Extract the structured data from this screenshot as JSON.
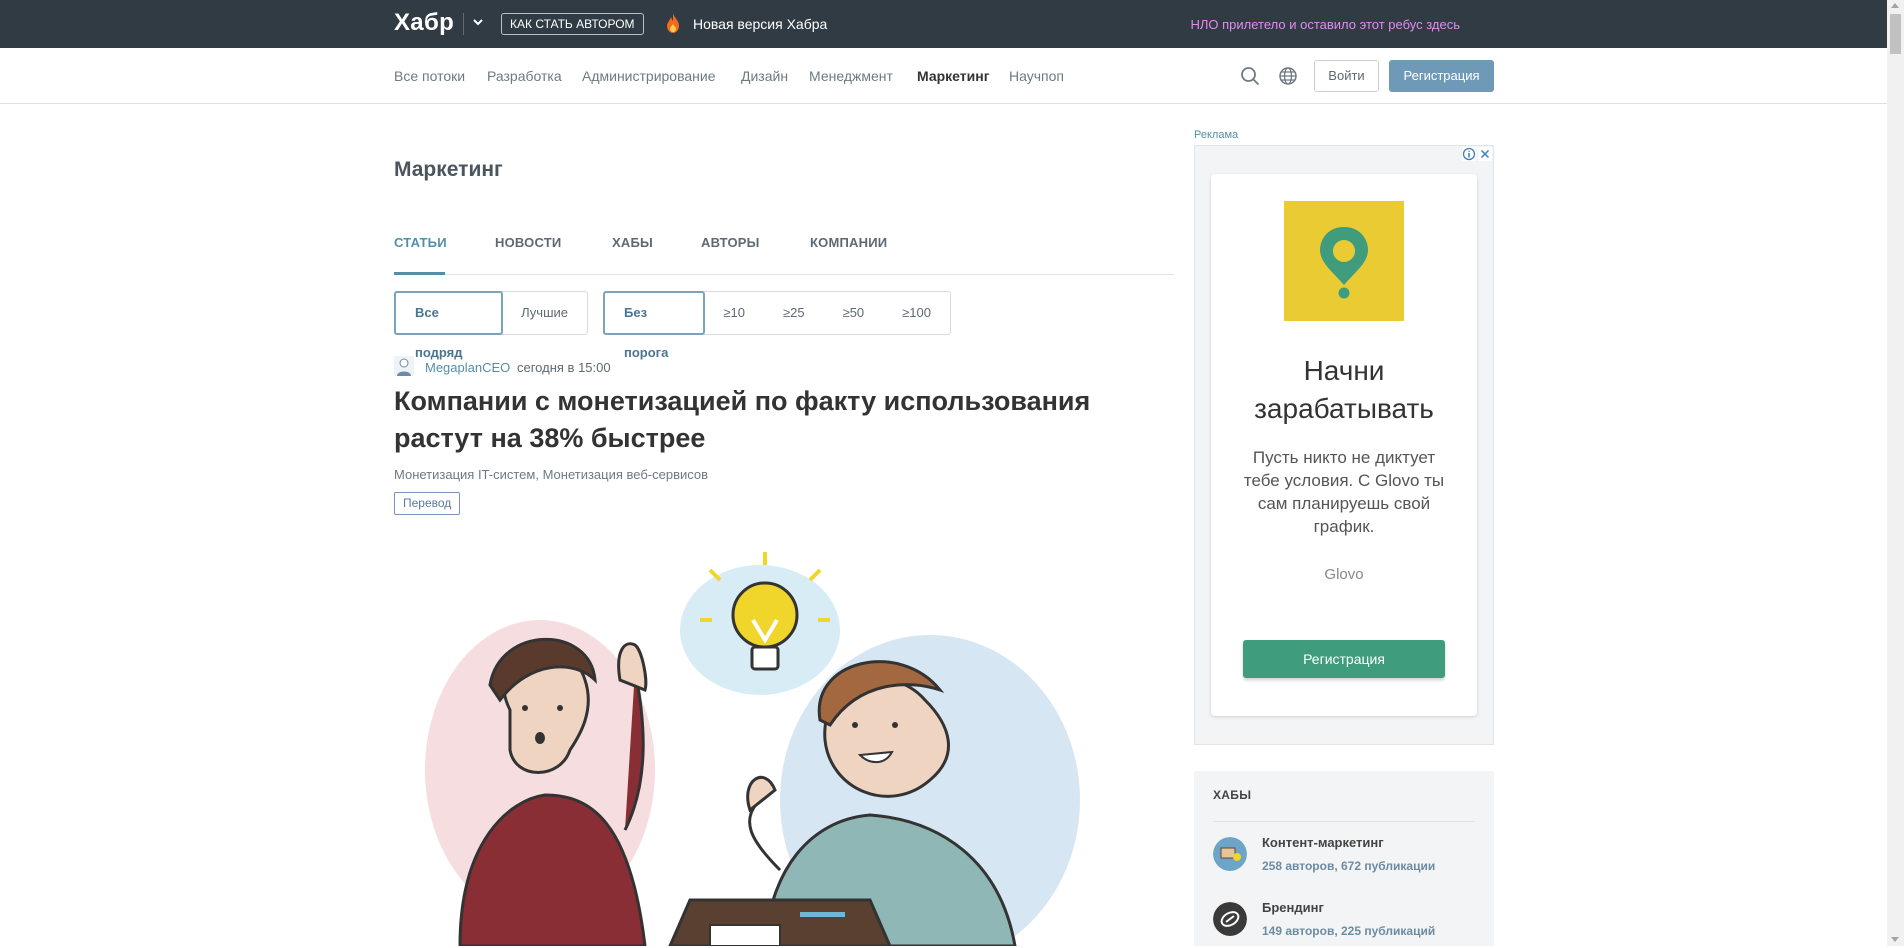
{
  "topbar": {
    "logo": "Хабр",
    "become_author": "КАК СТАТЬ АВТОРОМ",
    "new_version": "Новая версия Хабра",
    "ufo_note": "НЛО прилетело и оставило этот ребус здесь"
  },
  "nav": {
    "items": [
      "Все потоки",
      "Разработка",
      "Администрирование",
      "Дизайн",
      "Менеджмент",
      "Маркетинг",
      "Научпоп"
    ],
    "active": "Маркетинг",
    "login": "Войти",
    "register": "Регистрация"
  },
  "hub": {
    "title": "Маркетинг",
    "tabs": [
      "Статьи",
      "Новости",
      "Хабы",
      "Авторы",
      "Компании"
    ],
    "active_tab": "Статьи"
  },
  "filters": {
    "sort": [
      "Все подряд",
      "Лучшие"
    ],
    "sort_active": "Все подряд",
    "threshold": [
      "Без порога",
      "≥10",
      "≥25",
      "≥50",
      "≥100"
    ],
    "threshold_active": "Без порога"
  },
  "post": {
    "author": "MegaplanCEO",
    "time": "сегодня в 15:00",
    "title": "Компании с монетизацией по факту использования растут на 38% быстрее",
    "hubs": "Монетизация IT-систем,  Монетизация веб-сервисов",
    "badge": "Перевод"
  },
  "ad": {
    "label": "Реклама",
    "headline": "Начни зарабатывать",
    "body": "Пусть никто не диктует тебе условия. С Glovo ты сам планируешь свой график.",
    "brand": "Glovo",
    "cta": "Регистрация",
    "logo_color": "#ebcb33",
    "pin_color": "#3f9d7e"
  },
  "hubs_block": {
    "heading": "Хабы",
    "items": [
      {
        "name": "Контент-маркетинг",
        "stats": "258 авторов, 672 публикации"
      },
      {
        "name": "Брендинг",
        "stats": "149 авторов, 225 публикаций"
      }
    ]
  },
  "colors": {
    "topbar": "#303b44",
    "accent": "#548eaa",
    "register": "#6f9ab7",
    "ufo": "#e48bf0"
  }
}
